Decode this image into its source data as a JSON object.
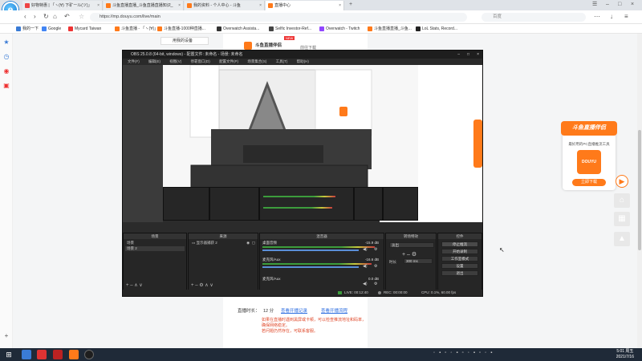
{
  "browser": {
    "tabs": [
      {
        "label": "好物特惠 | 「ヽ(∀) 下矿ール(ツ)」"
      },
      {
        "label": "斗鱼直播直播_斗鱼直播直播知识_"
      },
      {
        "label": "我的资料 - 个人中心 - 斗鱼"
      },
      {
        "label": "直播中心"
      }
    ],
    "new_tab": "+",
    "url": "https://mp.douyu.com/live/main",
    "search_placeholder": "百度",
    "bookmarks": [
      {
        "label": "我的一下"
      },
      {
        "label": "Google"
      },
      {
        "label": "Mycard Taiwan"
      },
      {
        "label": "斗鱼直播 - 「ヽ(∀)」"
      },
      {
        "label": "斗鱼直播-1000种直播..."
      },
      {
        "label": "Overwatch Assista..."
      },
      {
        "label": "Selfic Investor-Ref..."
      },
      {
        "label": "Overwatch - Twitch"
      },
      {
        "label": "斗鱼直播直播_斗鱼..."
      },
      {
        "label": "LoL Stats, Record..."
      }
    ]
  },
  "page": {
    "top_item": "用我的设备",
    "promo_top_title": "斗鱼直播伴侣",
    "promo_top_badge": "NEW",
    "promo_top_sub": "前往下载",
    "stats_label": "直播时长：",
    "stats_value": "12 分",
    "link1": "查看开播记录",
    "link2": "查看开播流程",
    "notice_line1": "如果在直播时遇到黑屏或卡顿，可以检查推流地址和码率，确保网络稳定。",
    "notice_line2": "若问题仍然存在，可联系客服。"
  },
  "obs": {
    "title": "OBS 25.0.8 (64-bit, windows) - 配置文件: 未命名 - 场景: 未命名",
    "menu": [
      "文件(F)",
      "编辑(E)",
      "视图(V)",
      "停靠窗口(D)",
      "配置文件(P)",
      "场景集合(S)",
      "工具(T)",
      "帮助(H)"
    ],
    "docks": {
      "scenes": {
        "title": "场景",
        "items": [
          "场景",
          "场景 2"
        ]
      },
      "sources": {
        "title": "来源",
        "items": [
          "显示器捕获 2"
        ]
      },
      "mixer": {
        "title": "混音器",
        "channels": [
          {
            "name": "桌面音频",
            "db": "-15.9 dB"
          },
          {
            "name": "麦克风/Aux",
            "db": "-16.6 dB"
          },
          {
            "name": "麦克风/Aux",
            "db": "0.0 dB"
          }
        ]
      },
      "transitions": {
        "title": "转场特效",
        "type": "淡出",
        "duration_label": "时长",
        "duration": "300 ms"
      },
      "controls": {
        "title": "控件",
        "buttons": [
          "停止推流",
          "开始录制",
          "工作室模式",
          "设置",
          "退出"
        ]
      }
    },
    "status": {
      "live": "LIVE: 00:12:40",
      "rec": "REC: 00:00:00",
      "cpu": "CPU: 0.1%, 60.00 fps"
    }
  },
  "promo": {
    "title": "斗鱼直播伴侣",
    "desc": "最好用的PC直播推流工具",
    "logo": "DOUYU",
    "download": "立即下载"
  },
  "taskbar": {
    "time": "5:01 周五",
    "date": "2021/7/16"
  }
}
